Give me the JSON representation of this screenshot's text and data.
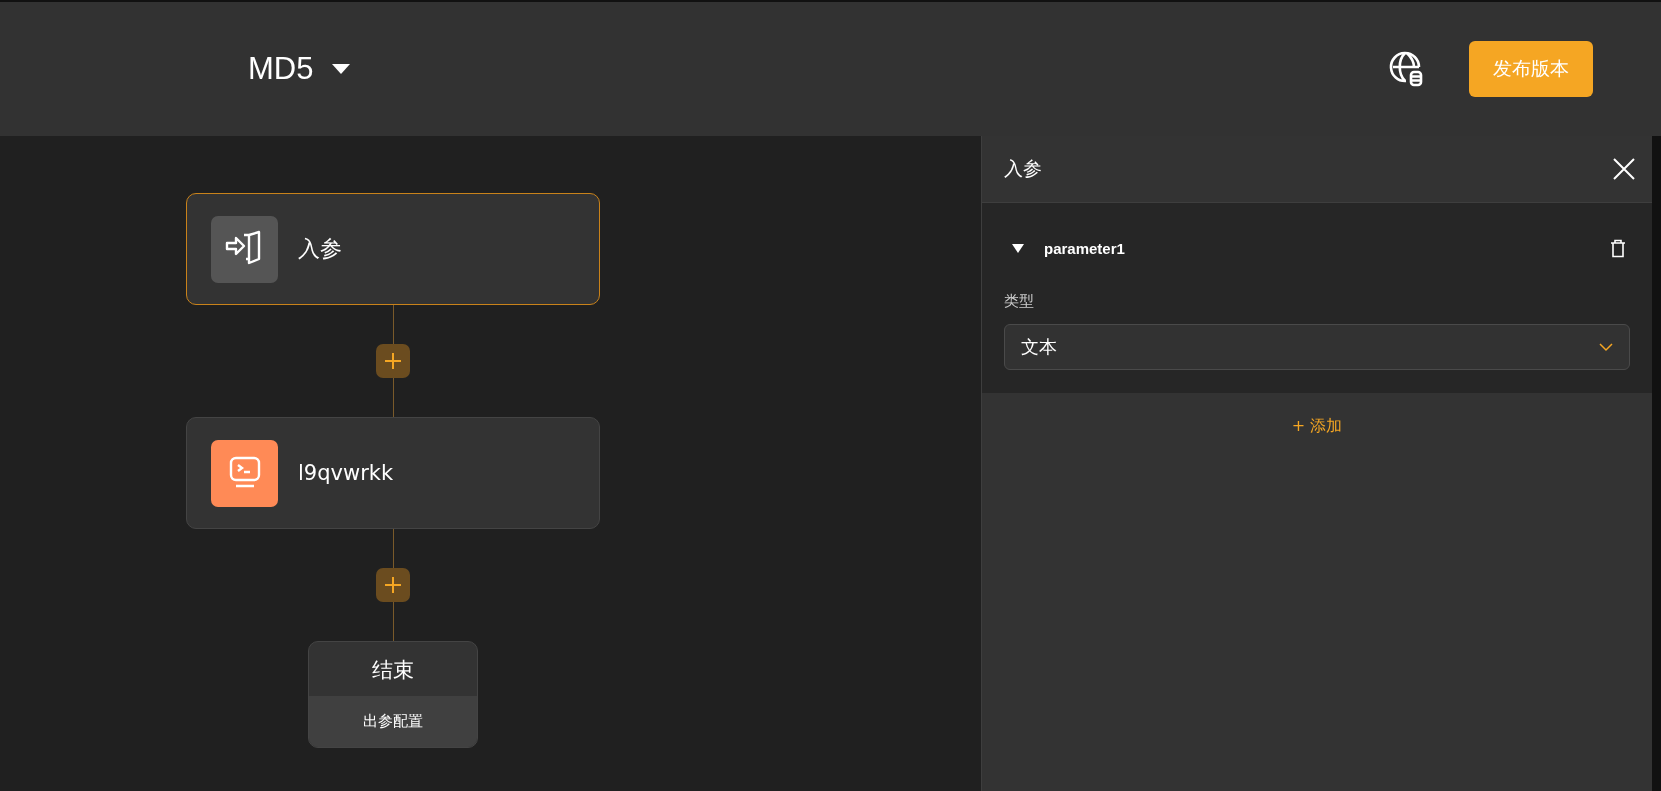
{
  "header": {
    "title": "MD5",
    "publish_button": "发布版本"
  },
  "nodes": [
    {
      "kind": "start",
      "label": "入参",
      "selected": true
    },
    {
      "kind": "code",
      "label": "l9qvwrkk",
      "selected": false
    },
    {
      "kind": "end",
      "label": "结束",
      "action": "出参配置",
      "selected": false
    }
  ],
  "panel": {
    "title": "入参",
    "parameters": [
      {
        "name": "parameter1",
        "expanded": true,
        "type_label": "类型",
        "type_value": "文本"
      }
    ],
    "add_button": "+ 添加"
  }
}
